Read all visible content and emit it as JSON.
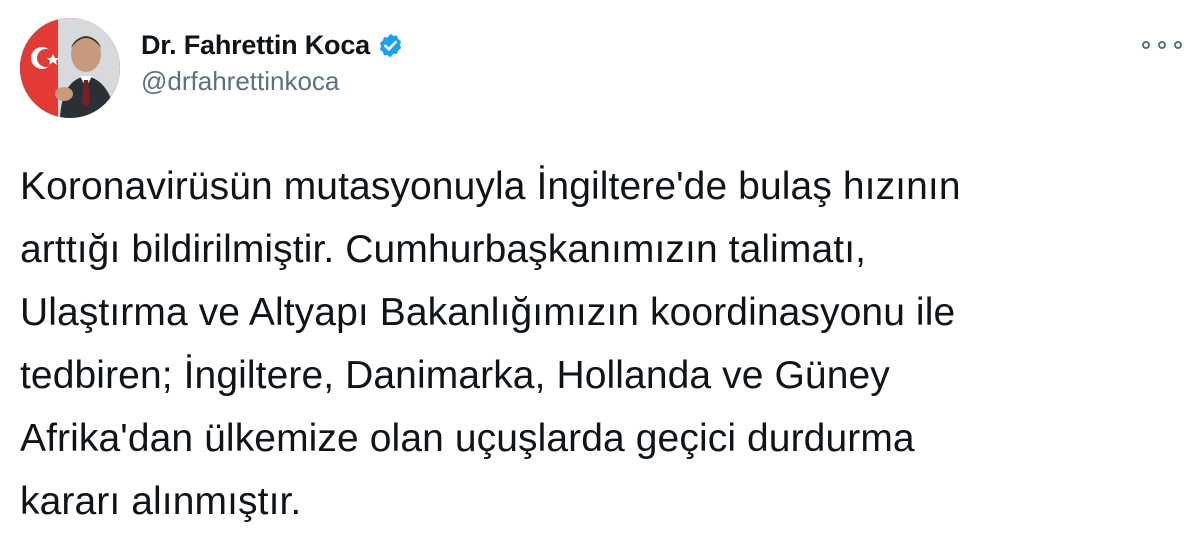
{
  "author": {
    "display_name": "Dr. Fahrettin Koca",
    "handle": "@drfahrettinkoca",
    "verified": true,
    "avatar_icon": "profile-photo",
    "verified_icon": "verified-badge-icon",
    "verified_color": "#1da1f2"
  },
  "menu": {
    "more_icon": "more-options-icon"
  },
  "tweet": {
    "text": "Koronavirüsün mutasyonuyla İngiltere'de bulaş hızının\narttığı bildirilmiştir. Cumhurbaşkanımızın talimatı,\nUlaştırma ve Altyapı Bakanlığımızın koordinasyonu ile\ntedbiren; İngiltere, Danimarka, Hollanda ve Güney\nAfrika'dan ülkemize olan uçuşlarda geçici durdurma\nkararı alınmıştır."
  },
  "colors": {
    "text_primary": "#0f1419",
    "text_secondary": "#5b7083",
    "accent": "#1da1f2",
    "background": "#ffffff"
  }
}
